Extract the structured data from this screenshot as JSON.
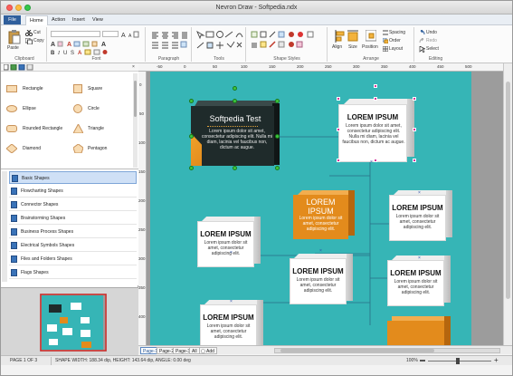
{
  "window": {
    "title": "Nevron Draw - Softpedia.ndx"
  },
  "menu": {
    "items": [
      "File",
      "Home",
      "Action",
      "Insert",
      "View"
    ],
    "active": "Home"
  },
  "ribbon": {
    "groups": [
      {
        "label": "Clipboard"
      },
      {
        "label": "Font"
      },
      {
        "label": "Paragraph"
      },
      {
        "label": "Tools"
      },
      {
        "label": "Shape Styles"
      },
      {
        "label": "Arrange"
      },
      {
        "label": "Editing"
      }
    ],
    "clipboard": {
      "paste": "Paste",
      "cut": "Cut",
      "copy": "Copy"
    },
    "arrange": {
      "align": "Align",
      "size": "Size",
      "position": "Position",
      "spacing": "Spacing",
      "order": "Order",
      "layout": "Layout"
    },
    "editing": {
      "undo": "Undo",
      "redo": "Redo",
      "select": "Select"
    }
  },
  "library": {
    "shapes": [
      {
        "name": "Rectangle"
      },
      {
        "name": "Square"
      },
      {
        "name": "Ellipse"
      },
      {
        "name": "Circle"
      },
      {
        "name": "Rounded Rectangle"
      },
      {
        "name": "Triangle"
      },
      {
        "name": "Diamond"
      },
      {
        "name": "Pentagon"
      }
    ],
    "categories": [
      {
        "label": "Basic Shapes",
        "selected": true
      },
      {
        "label": "Flowcharting Shapes"
      },
      {
        "label": "Connector Shapes"
      },
      {
        "label": "Brainstorming Shapes"
      },
      {
        "label": "Business Process Shapes"
      },
      {
        "label": "Electrical Symbols Shapes"
      },
      {
        "label": "Files and Folders Shapes"
      },
      {
        "label": "Flags Shapes"
      }
    ]
  },
  "ruler": {
    "h": [
      "-50",
      "0",
      "50",
      "100",
      "150",
      "200",
      "250",
      "300",
      "350",
      "400",
      "450",
      "500"
    ],
    "v": [
      "0",
      "50",
      "100",
      "150",
      "200",
      "250",
      "300",
      "350",
      "400"
    ]
  },
  "diagram": {
    "main": {
      "title": "Softpedia Test",
      "subtitle": "Lorem ipsum dolor sit amet, consectetur adipiscing elit. Nulla mi diam, lacinia vel faucibus non, dictum ac augue."
    },
    "top_node": {
      "title": "LOREM IPSUM",
      "body": "Lorem ipsum dolor sit amet, consectetur adipiscing elit. Nulla mi diam, lacinia vel faucibus non, dictum ac augue."
    },
    "small_body": "Lorem ipsum dolor sit amet, consectetur adipiscing elit.",
    "nodes": [
      {
        "title": "LOREM IPSUM",
        "style": "orange"
      },
      {
        "title": "LOREM IPSUM",
        "style": "white"
      },
      {
        "title": "LOREM IPSUM",
        "style": "white"
      },
      {
        "title": "LOREM IPSUM",
        "style": "white"
      },
      {
        "title": "LOREM IPSUM",
        "style": "white"
      },
      {
        "title": "LOREM IPSUM",
        "style": "white"
      }
    ],
    "colors": {
      "page": "#36b5b6",
      "main": "#1f2b2b",
      "orange": "#e38b1c",
      "handle": "#d7359c"
    }
  },
  "page_tabs": {
    "tabs": [
      "Page-1",
      "Page-2",
      "Page-3",
      "All"
    ],
    "selected": "Page-1",
    "add": "Add"
  },
  "status": {
    "page": "PAGE 1 OF 3",
    "shape": "SHAPE WIDTH: 188.34 dip, HEIGHT: 143.64 dip, ANGLE: 0.00 deg",
    "zoom": "100%"
  }
}
